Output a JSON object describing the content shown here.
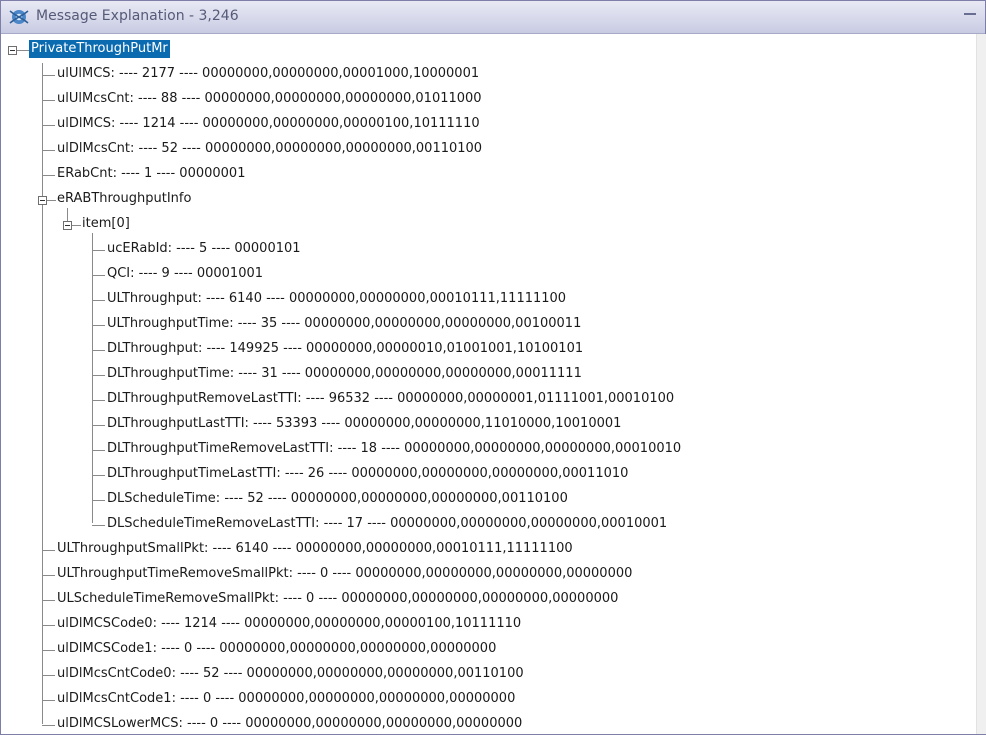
{
  "window": {
    "title": "Message Explanation - 3,246",
    "icon": "app-icon",
    "minimize_icon": "minimize-icon"
  },
  "tree": {
    "root": "PrivateThroughPutMr",
    "level1_top": [
      "ulUlMCS: ---- 2177 ---- 00000000,00000000,00001000,10000001",
      "ulUlMcsCnt: ---- 88 ---- 00000000,00000000,00000000,01011000",
      "ulDlMCS: ---- 1214 ---- 00000000,00000000,00000100,10111110",
      "ulDlMcsCnt: ---- 52 ---- 00000000,00000000,00000000,00110100",
      "ERabCnt: ---- 1 ---- 00000001"
    ],
    "erab_info": "eRABThroughputInfo",
    "item0": "item[0]",
    "item0_children": [
      "ucERabId: ---- 5 ---- 00000101",
      "QCI: ---- 9 ---- 00001001",
      "ULThroughput: ---- 6140 ---- 00000000,00000000,00010111,11111100",
      "ULThroughputTime: ---- 35 ---- 00000000,00000000,00000000,00100011",
      "DLThroughput: ---- 149925 ---- 00000000,00000010,01001001,10100101",
      "DLThroughputTime: ---- 31 ---- 00000000,00000000,00000000,00011111",
      "DLThroughputRemoveLastTTI: ---- 96532 ---- 00000000,00000001,01111001,00010100",
      "DLThroughputLastTTI: ---- 53393 ---- 00000000,00000000,11010000,10010001",
      "DLThroughputTimeRemoveLastTTI: ---- 18 ---- 00000000,00000000,00000000,00010010",
      "DLThroughputTimeLastTTI: ---- 26 ---- 00000000,00000000,00000000,00011010",
      "DLScheduleTime: ---- 52 ---- 00000000,00000000,00000000,00110100",
      "DLScheduleTimeRemoveLastTTI: ---- 17 ---- 00000000,00000000,00000000,00010001"
    ],
    "level1_bottom": [
      "ULThroughputSmallPkt: ---- 6140 ---- 00000000,00000000,00010111,11111100",
      "ULThroughputTimeRemoveSmallPkt: ---- 0 ---- 00000000,00000000,00000000,00000000",
      "ULScheduleTimeRemoveSmallPkt: ---- 0 ---- 00000000,00000000,00000000,00000000",
      "ulDlMCSCode0: ---- 1214 ---- 00000000,00000000,00000100,10111110",
      "ulDlMCSCode1: ---- 0 ---- 00000000,00000000,00000000,00000000",
      "ulDlMcsCntCode0: ---- 52 ---- 00000000,00000000,00000000,00110100",
      "ulDlMcsCntCode1: ---- 0 ---- 00000000,00000000,00000000,00000000",
      "ulDlMCSLowerMCS: ---- 0 ---- 00000000,00000000,00000000,00000000"
    ]
  }
}
